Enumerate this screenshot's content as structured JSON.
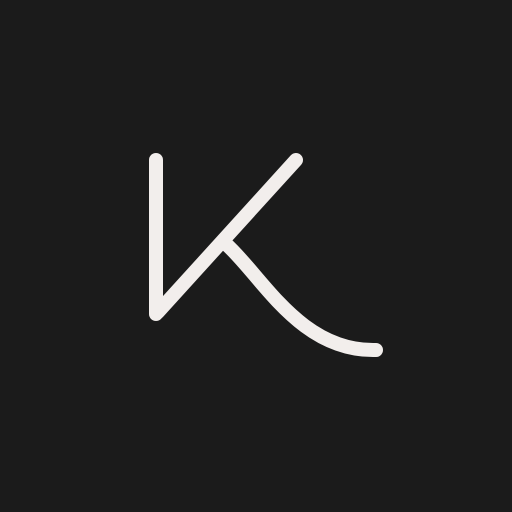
{
  "logo": {
    "icon": "letter-k-logo-icon",
    "letter": "K",
    "background_color": "#1b1b1b",
    "stroke_color": "#f2eeec"
  }
}
